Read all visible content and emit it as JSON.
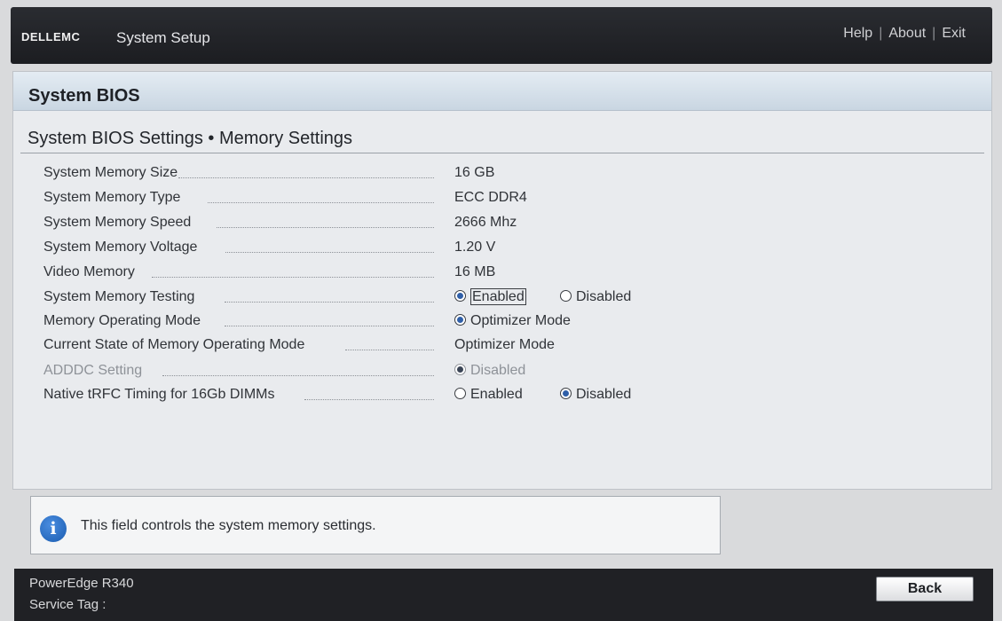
{
  "header": {
    "logo": "DELLEMC",
    "app_title": "System Setup",
    "links": [
      "Help",
      "About",
      "Exit"
    ]
  },
  "panel": {
    "title": "System BIOS",
    "breadcrumb": "System BIOS Settings • Memory Settings"
  },
  "settings": [
    {
      "label": "System Memory Size",
      "value": "16 GB"
    },
    {
      "label": "System Memory Type",
      "value": "ECC DDR4"
    },
    {
      "label": "System Memory Speed",
      "value": "2666 Mhz"
    },
    {
      "label": "System Memory Voltage",
      "value": "1.20 V"
    },
    {
      "label": "Video Memory",
      "value": "16 MB"
    },
    {
      "label": "System Memory Testing",
      "options": [
        "Enabled",
        "Disabled"
      ],
      "selected": "Enabled"
    },
    {
      "label": "Memory Operating Mode",
      "options": [
        "Optimizer Mode"
      ],
      "selected": "Optimizer Mode"
    },
    {
      "label": "Current State of Memory Operating Mode",
      "value": "Optimizer Mode"
    },
    {
      "label": "ADDDC Setting",
      "options": [
        "Disabled"
      ],
      "selected": "Disabled",
      "disabled": true
    },
    {
      "label": "Native tRFC Timing for 16Gb DIMMs",
      "options": [
        "Enabled",
        "Disabled"
      ],
      "selected": "Disabled"
    }
  ],
  "info": {
    "icon": "info-icon",
    "text": "This field controls the system memory settings."
  },
  "footer": {
    "model": "PowerEdge R340",
    "service_tag_label": "Service Tag :",
    "back_label": "Back"
  },
  "colors": {
    "header_bg": "#1c1d21",
    "panel_title_bg": "#c9d6e2",
    "radio_selected": "#2f5fa8",
    "info_icon": "#1a5cb0"
  }
}
